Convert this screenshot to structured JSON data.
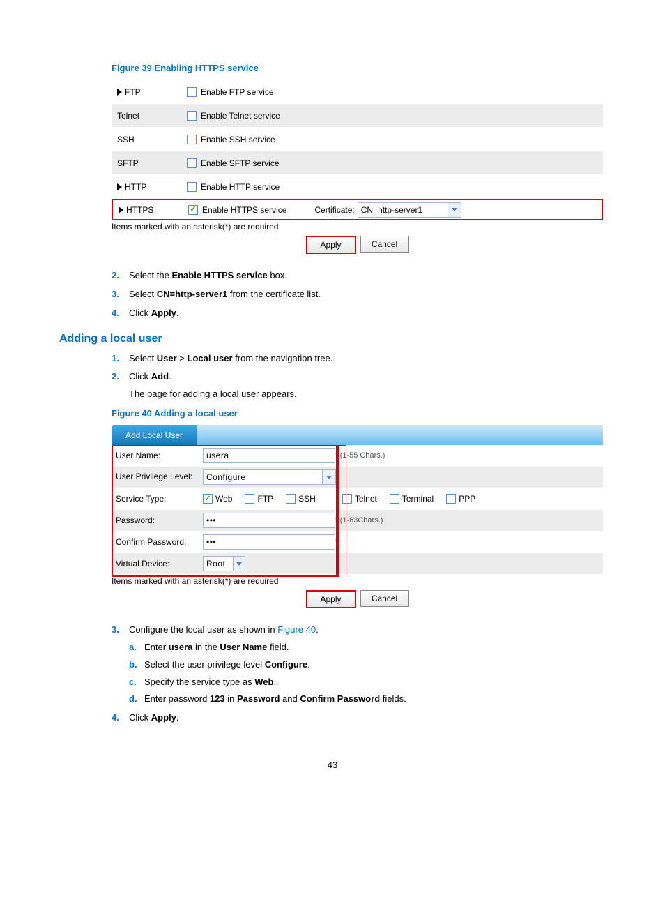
{
  "figure39": {
    "caption": "Figure 39 Enabling HTTPS service",
    "rows": {
      "ftp": {
        "label": "FTP",
        "cb_label": "Enable FTP service"
      },
      "telnet": {
        "label": "Telnet",
        "cb_label": "Enable Telnet service"
      },
      "ssh": {
        "label": "SSH",
        "cb_label": "Enable SSH service"
      },
      "sftp": {
        "label": "SFTP",
        "cb_label": "Enable SFTP service"
      },
      "http": {
        "label": "HTTP",
        "cb_label": "Enable HTTP service"
      },
      "https": {
        "label": "HTTPS",
        "cb_label": "Enable HTTPS service",
        "cert_label": "Certificate:",
        "cert_value": "CN=http-server1"
      }
    },
    "note": "Items marked with an asterisk(*) are required",
    "apply": "Apply",
    "cancel": "Cancel"
  },
  "steps_a": {
    "s2": {
      "num": "2.",
      "pre": "Select the ",
      "bold": "Enable HTTPS service",
      "post": " box."
    },
    "s3": {
      "num": "3.",
      "pre": "Select ",
      "bold": "CN=http-server1",
      "post": " from the certificate list."
    },
    "s4": {
      "num": "4.",
      "pre": "Click ",
      "bold": "Apply",
      "post": "."
    }
  },
  "heading_add_user": "Adding a local user",
  "steps_b": {
    "s1": {
      "num": "1.",
      "pre": "Select ",
      "b1": "User",
      "mid": " > ",
      "b2": "Local user",
      "post": " from the navigation tree."
    },
    "s2": {
      "num": "2.",
      "pre": "Click ",
      "bold": "Add",
      "post": ".",
      "indent": "The page for adding a local user appears."
    }
  },
  "figure40": {
    "caption": "Figure 40 Adding a local user",
    "tab": "Add Local User",
    "labels": {
      "username": "User Name:",
      "priv": "User Privilege Level:",
      "svc": "Service Type:",
      "pwd": "Password:",
      "cpwd": "Confirm Password:",
      "vdev": "Virtual Device:"
    },
    "values": {
      "username": "usera",
      "priv": "Configure",
      "pwd": "•••",
      "cpwd": "•••",
      "vdev": "Root"
    },
    "hints": {
      "username": "(1-55 Chars.)",
      "pwd": "(1-63Chars.)"
    },
    "svc": {
      "web": "Web",
      "ftp": "FTP",
      "ssh": "SSH",
      "telnet": "Telnet",
      "terminal": "Terminal",
      "ppp": "PPP"
    },
    "note": "Items marked with an asterisk(*) are required",
    "apply": "Apply",
    "cancel": "Cancel"
  },
  "steps_c": {
    "s3": {
      "num": "3.",
      "pre": "Configure the local user as shown in ",
      "link": "Figure 40",
      "post": "."
    },
    "a": {
      "letter": "a.",
      "pre": "Enter ",
      "b1": "usera",
      "mid": " in the ",
      "b2": "User Name",
      "post": " field."
    },
    "b": {
      "letter": "b.",
      "pre": "Select the user privilege level ",
      "b1": "Configure",
      "post": "."
    },
    "c": {
      "letter": "c.",
      "pre": "Specify the service type as ",
      "b1": "Web",
      "post": "."
    },
    "d": {
      "letter": "d.",
      "pre": "Enter password ",
      "b1": "123",
      "mid": " in ",
      "b2": "Password",
      "mid2": " and ",
      "b3": "Confirm Password",
      "post": " fields."
    },
    "s4": {
      "num": "4.",
      "pre": "Click ",
      "bold": "Apply",
      "post": "."
    }
  },
  "page_number": "43"
}
